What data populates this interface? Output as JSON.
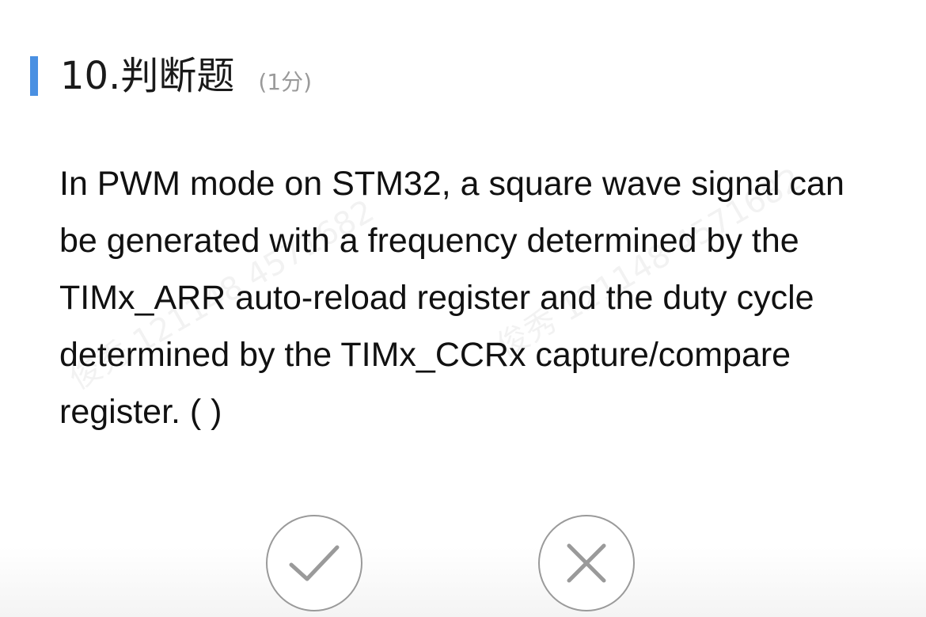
{
  "question": {
    "title": "10.判断题",
    "score": "(1分)",
    "text": "In PWM mode on STM32, a square wave signal can be generated with a frequency determined by the TIMx_ARR auto-reload register and the duty cycle determined by the TIMx_CCRx capture/compare register. ( )"
  },
  "watermark": {
    "text": "俊秀 121148 4571682"
  },
  "answers": {
    "true_icon": "check-icon",
    "false_icon": "close-icon"
  },
  "colors": {
    "accent": "#4a90e2",
    "icon_stroke": "#9a9a9a"
  }
}
